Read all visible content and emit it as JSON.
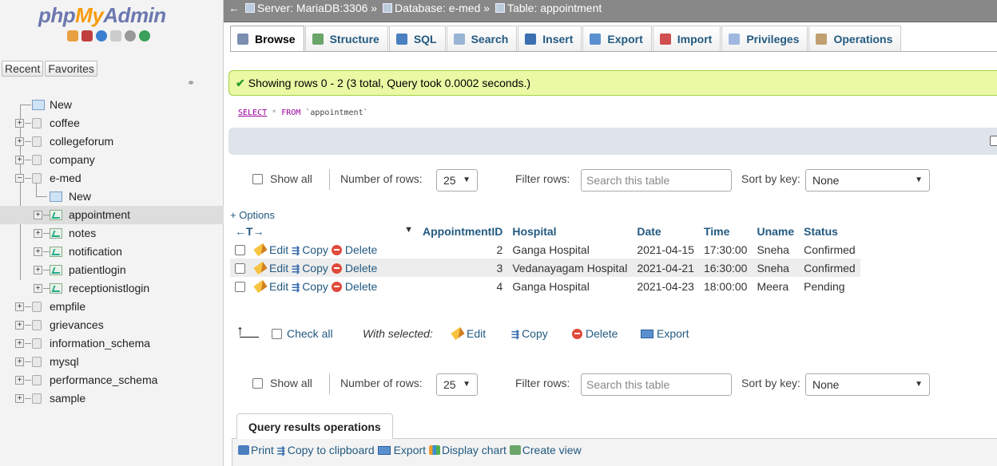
{
  "sidebar": {
    "logo": {
      "part1": "php",
      "part2": "My",
      "part3": "Admin"
    },
    "recent_label": "Recent",
    "favorites_label": "Favorites",
    "new_label": "New",
    "databases": [
      "coffee",
      "collegeforum",
      "company",
      "e-med",
      "empfile",
      "grievances",
      "information_schema",
      "mysql",
      "performance_schema",
      "sample"
    ],
    "emed_new": "New",
    "emed_tables": [
      "appointment",
      "notes",
      "notification",
      "patientlogin",
      "receptionistlogin"
    ],
    "selected_table": "appointment"
  },
  "breadcrumb": {
    "server": "Server: MariaDB:3306",
    "sep1": "»",
    "database": "Database: e-med",
    "sep2": "»",
    "table": "Table: appointment"
  },
  "tabs": [
    {
      "label": "Browse",
      "color": "#7c8fb0"
    },
    {
      "label": "Structure",
      "color": "#6aa56a"
    },
    {
      "label": "SQL",
      "color": "#4a7fc0"
    },
    {
      "label": "Search",
      "color": "#9ab4d4"
    },
    {
      "label": "Insert",
      "color": "#3a6fb0"
    },
    {
      "label": "Export",
      "color": "#5a8fd0"
    },
    {
      "label": "Import",
      "color": "#d05050"
    },
    {
      "label": "Privileges",
      "color": "#a0b8e0"
    },
    {
      "label": "Operations",
      "color": "#c0a070"
    }
  ],
  "message": "Showing rows 0 - 2 (3 total, Query took 0.0002 seconds.)",
  "sql": {
    "select": "SELECT",
    "star": "*",
    "from": "FROM",
    "table": "`appointment`"
  },
  "nav": {
    "show_all": "Show all",
    "number_of_rows": "Number of rows:",
    "rows_value": "25",
    "filter_rows": "Filter rows:",
    "search_placeholder": "Search this table",
    "sort_by_key": "Sort by key:",
    "sort_value": "None"
  },
  "options_link": "+ Options",
  "arrows": "←T→",
  "table": {
    "columns": [
      "AppointmentID",
      "Hospital",
      "Date",
      "Time",
      "Uname",
      "Status"
    ],
    "actions": {
      "edit": "Edit",
      "copy": "Copy",
      "delete": "Delete"
    },
    "rows": [
      {
        "id": "2",
        "hospital": "Ganga Hospital",
        "date": "2021-04-15",
        "time": "17:30:00",
        "uname": "Sneha",
        "status": "Confirmed"
      },
      {
        "id": "3",
        "hospital": "Vedanayagam Hospital",
        "date": "2021-04-21",
        "time": "16:30:00",
        "uname": "Sneha",
        "status": "Confirmed"
      },
      {
        "id": "4",
        "hospital": "Ganga Hospital",
        "date": "2021-04-23",
        "time": "18:00:00",
        "uname": "Meera",
        "status": "Pending"
      }
    ]
  },
  "bulk": {
    "check_all": "Check all",
    "with_selected": "With selected:",
    "edit": "Edit",
    "copy": "Copy",
    "delete": "Delete",
    "export": "Export"
  },
  "qro": {
    "title": "Query results operations",
    "print": "Print",
    "copy": "Copy to clipboard",
    "export": "Export",
    "chart": "Display chart",
    "view": "Create view"
  }
}
